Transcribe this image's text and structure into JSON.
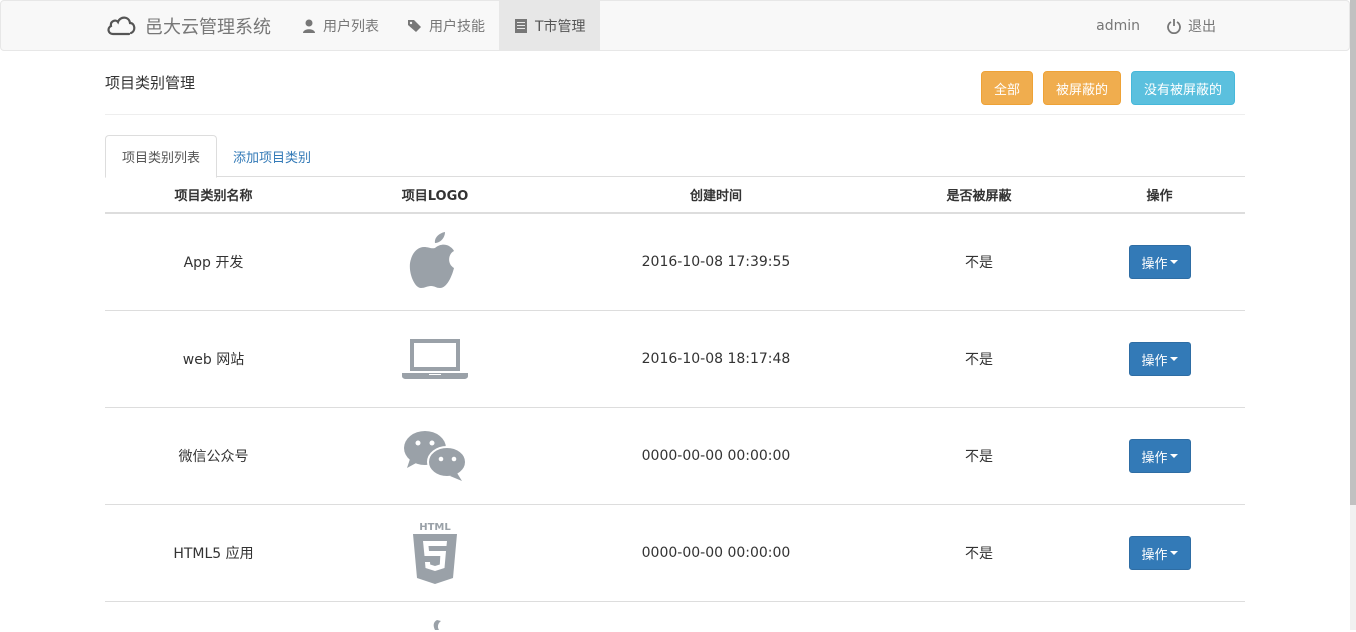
{
  "navbar": {
    "brand": "邑大云管理系统",
    "items": [
      {
        "label": "用户列表",
        "icon": "user-icon"
      },
      {
        "label": "用户技能",
        "icon": "tags-icon"
      },
      {
        "label": "T市管理",
        "icon": "list-alt-icon"
      }
    ],
    "user": "admin",
    "logout": "退出"
  },
  "header": {
    "title": "项目类别管理",
    "filter_all": "全部",
    "filter_blocked": "被屏蔽的",
    "filter_unblocked": "没有被屏蔽的"
  },
  "tabs": [
    "项目类别列表",
    "添加项目类别"
  ],
  "table": {
    "columns": [
      "项目类别名称",
      "项目LOGO",
      "创建时间",
      "是否被屏蔽",
      "操作"
    ],
    "rows": [
      {
        "name": "App 开发",
        "logo": "apple-icon",
        "created": "2016-10-08 17:39:55",
        "blocked": "不是",
        "action": "操作"
      },
      {
        "name": "web 网站",
        "logo": "laptop-icon",
        "created": "2016-10-08 18:17:48",
        "blocked": "不是",
        "action": "操作"
      },
      {
        "name": "微信公众号",
        "logo": "wechat-icon",
        "created": "0000-00-00 00:00:00",
        "blocked": "不是",
        "action": "操作"
      },
      {
        "name": "HTML5 应用",
        "logo": "html5-icon",
        "created": "0000-00-00 00:00:00",
        "blocked": "不是",
        "action": "操作"
      }
    ]
  },
  "colors": {
    "primary": "#337ab7",
    "warning": "#f0ad4e",
    "info": "#5bc0de",
    "icon": "#9aa1a8"
  }
}
